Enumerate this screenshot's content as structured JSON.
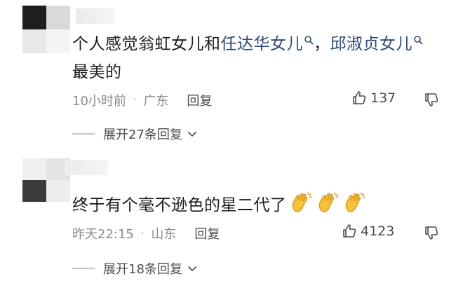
{
  "comments": [
    {
      "text_plain": "个人感觉翁虹女儿和",
      "link1": "任达华女儿",
      "sep": "，",
      "link2": "邱淑贞女儿",
      "line2": "最美的",
      "time": "10小时前",
      "dot": "·",
      "location": "广东",
      "reply_label": "回复",
      "likes": "137",
      "expand_label": "展开27条回复"
    },
    {
      "text_plain": "终于有个毫不逊色的星二代了",
      "time": "昨天22:15",
      "dot": "·",
      "location": "山东",
      "reply_label": "回复",
      "likes": "4123",
      "expand_label": "展开18条回复"
    }
  ],
  "icons": {
    "like": "thumbs-up-icon",
    "dislike": "thumbs-down-icon",
    "search": "search-icon",
    "chevron": "chevron-down-icon",
    "emoji": "clapping-hands-emoji"
  },
  "colors": {
    "link": "#2d4a78",
    "meta": "#8c8c8c",
    "text": "#1a1a1a"
  }
}
